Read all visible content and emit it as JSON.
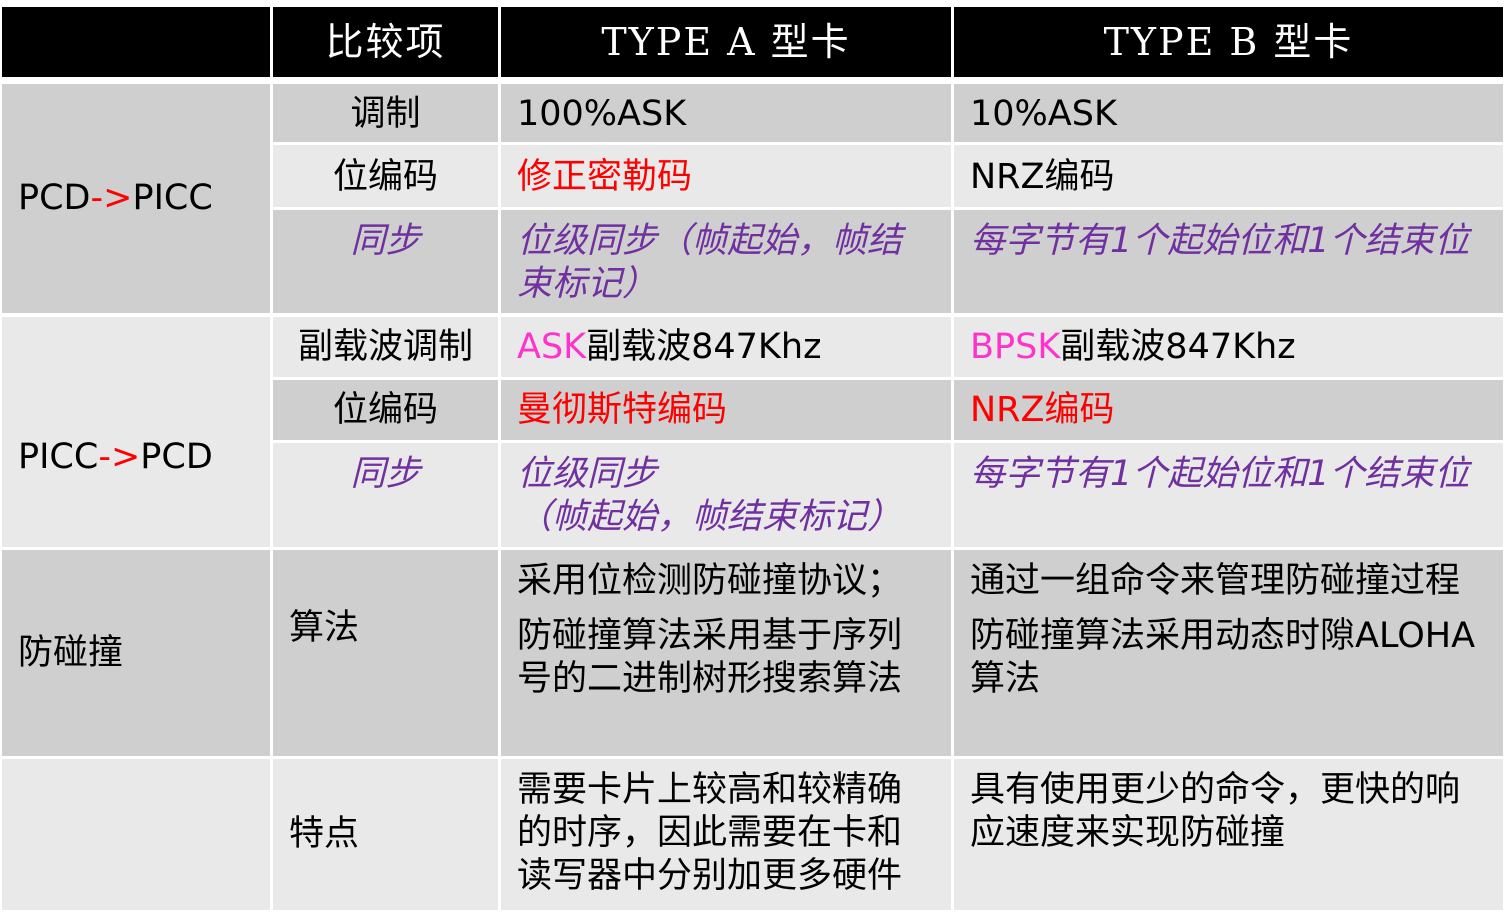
{
  "header": {
    "col0": "",
    "col1": "比较项",
    "col2": "TYPE A 型卡",
    "col3": "TYPE B 型卡"
  },
  "groups": {
    "pcd_to_picc": {
      "label_a": "PCD",
      "arrow": "->",
      "label_b": "PICC"
    },
    "picc_to_pcd": {
      "label_a": "PICC",
      "arrow": "->",
      "label_b": "PCD"
    },
    "anticollision": "防碰撞",
    "features": ""
  },
  "rows": {
    "modulation": {
      "item": "调制",
      "type_a": "100%ASK",
      "type_b": "10%ASK"
    },
    "bit_encoding_1": {
      "item": "位编码",
      "type_a": "修正密勒码",
      "type_b": "NRZ编码"
    },
    "sync_1": {
      "item": "同步",
      "type_a": "位级同步（帧起始，帧结束标记）",
      "type_b": "每字节有1个起始位和1个结束位"
    },
    "subcarrier": {
      "item": "副载波调制",
      "type_a_hl": "ASK",
      "type_a_rest": "副载波847Khz",
      "type_b_hl": "BPSK",
      "type_b_rest": "副载波847Khz"
    },
    "bit_encoding_2": {
      "item": "位编码",
      "type_a": "曼彻斯特编码",
      "type_b": "NRZ编码"
    },
    "sync_2": {
      "item": "同步",
      "type_a_line1": "位级同步",
      "type_a_line2": "（帧起始，帧结束标记）",
      "type_b": "每字节有1个起始位和1个结束位"
    },
    "algorithm": {
      "item": "算法",
      "type_a_p1": "采用位检测防碰撞协议；",
      "type_a_p2": "防碰撞算法采用基于序列号的二进制树形搜索算法",
      "type_b_p1": "通过一组命令来管理防碰撞过程",
      "type_b_p2": "防碰撞算法采用动态时隙ALOHA算法"
    },
    "characteristics": {
      "item": "特点",
      "type_a": "需要卡片上较高和较精确的时序，因此需要在卡和读写器中分别加更多硬件",
      "type_b": "具有使用更少的命令，更快的响应速度来实现防碰撞"
    }
  },
  "colors": {
    "header_bg": "#000000",
    "row_dark": "#cfcfcf",
    "row_light": "#e9e9e9",
    "red": "#ff0000",
    "pink": "#ff33cc",
    "purple": "#7030a0"
  }
}
